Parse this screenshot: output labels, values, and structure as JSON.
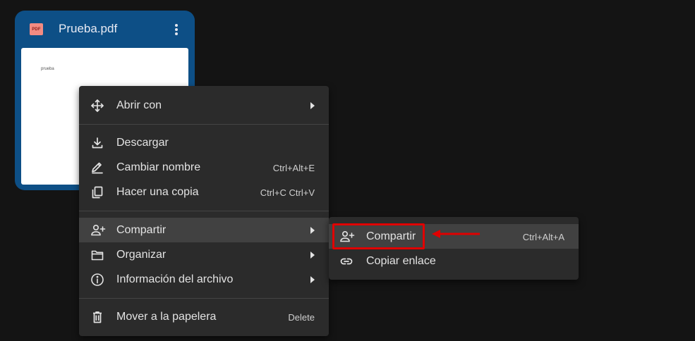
{
  "file_card": {
    "badge": "PDF",
    "file_name": "Prueba.pdf",
    "preview_text": "prueba"
  },
  "menu": {
    "items": [
      {
        "label": "Abrir con",
        "icon": "move-arrows-icon",
        "submenu": true
      },
      {
        "label": "Descargar",
        "icon": "download-icon"
      },
      {
        "label": "Cambiar nombre",
        "icon": "pencil-icon",
        "shortcut": "Ctrl+Alt+E"
      },
      {
        "label": "Hacer una copia",
        "icon": "copy-icon",
        "shortcut": "Ctrl+C Ctrl+V"
      },
      {
        "label": "Compartir",
        "icon": "person-add-icon",
        "submenu": true,
        "active": true
      },
      {
        "label": "Organizar",
        "icon": "folder-icon",
        "submenu": true
      },
      {
        "label": "Información del archivo",
        "icon": "info-icon",
        "submenu": true
      },
      {
        "label": "Mover a la papelera",
        "icon": "trash-icon",
        "shortcut": "Delete"
      }
    ]
  },
  "submenu": {
    "items": [
      {
        "label": "Compartir",
        "icon": "person-add-icon",
        "shortcut": "Ctrl+Alt+A",
        "active": true
      },
      {
        "label": "Copiar enlace",
        "icon": "link-icon"
      }
    ]
  },
  "colors": {
    "card_bg": "#0d4f86",
    "menu_bg": "#2b2b2b",
    "active_bg": "#414141",
    "annotation_red": "#e00000"
  }
}
